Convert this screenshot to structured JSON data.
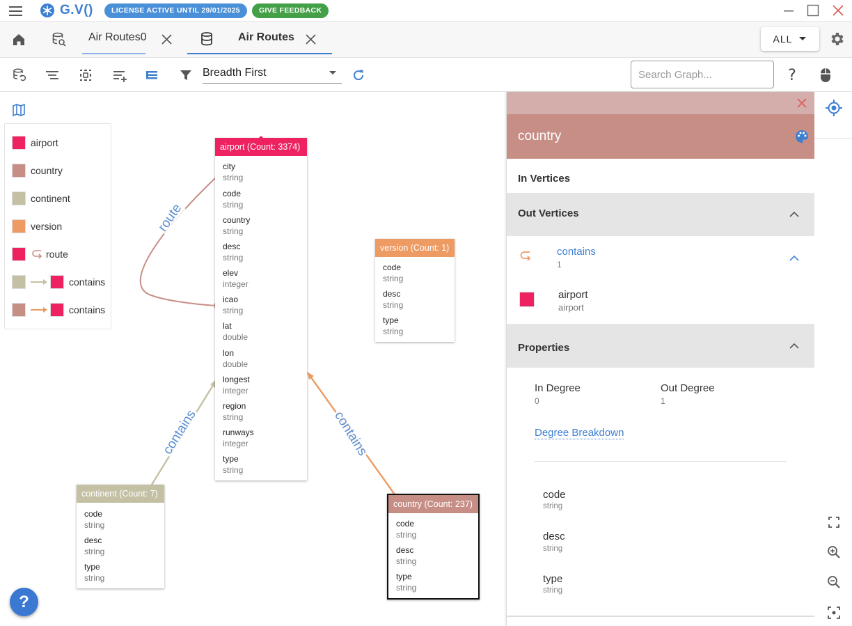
{
  "app": {
    "brand": "G.V()",
    "license_badge": "LICENSE ACTIVE UNTIL 29/01/2025",
    "feedback_badge": "GIVE FEEDBACK",
    "colors": {
      "brand": "#3c7fd1",
      "license": "#4a90d9",
      "feedback": "#43a047"
    }
  },
  "tabs": [
    {
      "label": "Air Routes0",
      "active": false
    },
    {
      "label": "Air Routes",
      "active": true
    }
  ],
  "header": {
    "scope_select": "ALL"
  },
  "toolbar": {
    "layout_select": "Breadth First",
    "search_placeholder": "Search Graph..."
  },
  "legend": {
    "items": [
      {
        "label": "airport",
        "color": "#ee2261"
      },
      {
        "label": "country",
        "color": "#c78e86"
      },
      {
        "label": "continent",
        "color": "#c4c0a4"
      },
      {
        "label": "version",
        "color": "#ee9a63"
      },
      {
        "label": "route",
        "color": "#ee2261",
        "icon": "self-loop-icon"
      },
      {
        "label": "contains",
        "from": "#c4c0a4",
        "to": "#ee2261"
      },
      {
        "label": "contains",
        "from": "#c78e86",
        "to": "#ee2261"
      }
    ]
  },
  "vertices": {
    "airport": {
      "title": "airport (Count: 3374)",
      "color": "#ee2261",
      "props": [
        {
          "name": "city",
          "type": "string"
        },
        {
          "name": "code",
          "type": "string"
        },
        {
          "name": "country",
          "type": "string"
        },
        {
          "name": "desc",
          "type": "string"
        },
        {
          "name": "elev",
          "type": "integer"
        },
        {
          "name": "icao",
          "type": "string"
        },
        {
          "name": "lat",
          "type": "double"
        },
        {
          "name": "lon",
          "type": "double"
        },
        {
          "name": "longest",
          "type": "integer"
        },
        {
          "name": "region",
          "type": "string"
        },
        {
          "name": "runways",
          "type": "integer"
        },
        {
          "name": "type",
          "type": "string"
        }
      ]
    },
    "version": {
      "title": "version (Count: 1)",
      "color": "#ee9a63",
      "props": [
        {
          "name": "code",
          "type": "string"
        },
        {
          "name": "desc",
          "type": "string"
        },
        {
          "name": "type",
          "type": "string"
        }
      ]
    },
    "continent": {
      "title": "continent (Count: 7)",
      "color": "#c4c0a4",
      "props": [
        {
          "name": "code",
          "type": "string"
        },
        {
          "name": "desc",
          "type": "string"
        },
        {
          "name": "type",
          "type": "string"
        }
      ]
    },
    "country": {
      "title": "country (Count: 237)",
      "color": "#c78e86",
      "props": [
        {
          "name": "code",
          "type": "string"
        },
        {
          "name": "desc",
          "type": "string"
        },
        {
          "name": "type",
          "type": "string"
        }
      ]
    }
  },
  "edges": {
    "route": "route",
    "contains_continent": "contains",
    "contains_country": "contains"
  },
  "panel": {
    "title": "country",
    "header_color": "#c78e86",
    "in_vertices": "In Vertices",
    "out_vertices": "Out Vertices",
    "out_edge": {
      "label": "contains",
      "count": "1"
    },
    "out_target": {
      "label": "airport",
      "sub": "airport",
      "color": "#ee2261"
    },
    "properties_title": "Properties",
    "in_degree_label": "In Degree",
    "in_degree_value": "0",
    "out_degree_label": "Out Degree",
    "out_degree_value": "1",
    "degree_breakdown": "Degree Breakdown",
    "props": [
      {
        "name": "code",
        "type": "string"
      },
      {
        "name": "desc",
        "type": "string"
      },
      {
        "name": "type",
        "type": "string"
      }
    ]
  },
  "help_button": "?"
}
